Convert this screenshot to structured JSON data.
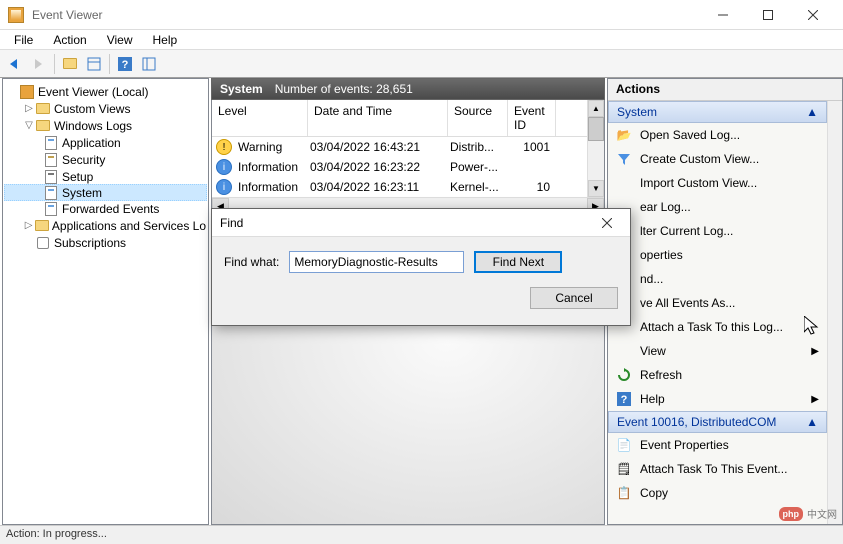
{
  "window": {
    "title": "Event Viewer"
  },
  "menu": [
    "File",
    "Action",
    "View",
    "Help"
  ],
  "tree": {
    "root": "Event Viewer (Local)",
    "custom_views": "Custom Views",
    "windows_logs": "Windows Logs",
    "logs": [
      "Application",
      "Security",
      "Setup",
      "System",
      "Forwarded Events"
    ],
    "apps_services": "Applications and Services Lo",
    "subscriptions": "Subscriptions"
  },
  "center": {
    "header_label": "System",
    "header_count": "Number of events: 28,651",
    "columns": {
      "level": "Level",
      "date": "Date and Time",
      "source": "Source",
      "eid": "Event ID"
    },
    "rows": [
      {
        "level": "Warning",
        "date": "03/04/2022 16:43:21",
        "source": "Distrib...",
        "eid": "1001",
        "type": "warn"
      },
      {
        "level": "Information",
        "date": "03/04/2022 16:23:22",
        "source": "Power-...",
        "eid": "",
        "type": "info"
      },
      {
        "level": "Information",
        "date": "03/04/2022 16:23:11",
        "source": "Kernel-...",
        "eid": "10",
        "type": "info"
      }
    ]
  },
  "actions": {
    "title": "Actions",
    "section1": "System",
    "items1": [
      "Open Saved Log...",
      "Create Custom View...",
      "Import Custom View...",
      "ear Log...",
      "lter Current Log...",
      "operties",
      "nd...",
      "ve All Events As...",
      "Attach a Task To this Log...",
      "View",
      "Refresh",
      "Help"
    ],
    "section2": "Event 10016, DistributedCOM",
    "items2": [
      "Event Properties",
      "Attach Task To This Event...",
      "Copy"
    ]
  },
  "find": {
    "title": "Find",
    "label": "Find what:",
    "value": "MemoryDiagnostic-Results",
    "next": "Find Next",
    "cancel": "Cancel"
  },
  "status": "Action:  In progress...",
  "watermark": {
    "badge": "php",
    "text": "中文网"
  }
}
